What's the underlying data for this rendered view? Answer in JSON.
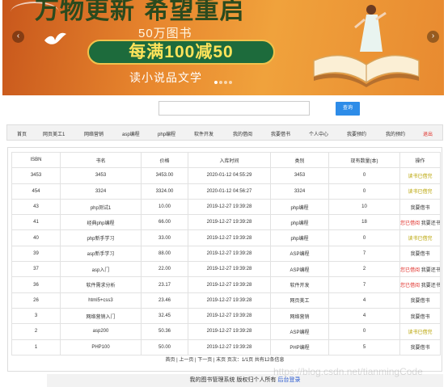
{
  "banner": {
    "title": "万物更新 希望重启",
    "subtitle": "50万图书",
    "promo": "每满100减50",
    "tagline": "读小说品文学",
    "prev_icon": "chevron-left-icon",
    "next_icon": "chevron-right-icon",
    "slide_count": 4,
    "active_slide": 1
  },
  "search": {
    "placeholder": "",
    "value": "",
    "button": "查询"
  },
  "nav": {
    "items": [
      "首页",
      "网页美工1",
      "网络营销",
      "asp编程",
      "php编程",
      "软件开发",
      "我的借阅",
      "我要借书",
      "个人中心",
      "我要预约",
      "我的预约",
      "退出"
    ]
  },
  "table": {
    "headers": [
      "ISBN",
      "书名",
      "价格",
      "入库时间",
      "类别",
      "现有数量(本)",
      "操作"
    ],
    "rows": [
      {
        "isbn": "3453",
        "name": "3453",
        "price": "3453.00",
        "time": "2020-01-12 04:55:29",
        "cat": "3453",
        "qty": "0",
        "op": "读书已借完",
        "op2": "",
        "opType": "done"
      },
      {
        "isbn": "454",
        "name": "3324",
        "price": "3324.00",
        "time": "2020-01-12 04:56:27",
        "cat": "3324",
        "qty": "0",
        "op": "读书已借完",
        "op2": "",
        "opType": "done"
      },
      {
        "isbn": "43",
        "name": "php测试1",
        "price": "10.00",
        "time": "2019-12-27 19:39:28",
        "cat": "php编程",
        "qty": "10",
        "op": "我要借书",
        "op2": "",
        "opType": "borrow"
      },
      {
        "isbn": "41",
        "name": "经典php编程",
        "price": "66.00",
        "time": "2019-12-27 19:39:28",
        "cat": "php编程",
        "qty": "18",
        "op": "您已借阅",
        "op2": "我要还书",
        "opType": "borrowed"
      },
      {
        "isbn": "40",
        "name": "php新手学习",
        "price": "33.00",
        "time": "2019-12-27 19:39:28",
        "cat": "php编程",
        "qty": "0",
        "op": "读书已借完",
        "op2": "",
        "opType": "done"
      },
      {
        "isbn": "39",
        "name": "asp新手学习",
        "price": "88.00",
        "time": "2019-12-27 19:39:28",
        "cat": "ASP编程",
        "qty": "7",
        "op": "我要借书",
        "op2": "",
        "opType": "borrow"
      },
      {
        "isbn": "37",
        "name": "asp入门",
        "price": "22.00",
        "time": "2019-12-27 19:39:28",
        "cat": "ASP编程",
        "qty": "2",
        "op": "您已借阅",
        "op2": "我要还书",
        "opType": "borrowed"
      },
      {
        "isbn": "36",
        "name": "软件需求分析",
        "price": "23.17",
        "time": "2019-12-27 19:39:28",
        "cat": "软件开发",
        "qty": "7",
        "op": "您已借阅",
        "op2": "我要还书",
        "opType": "borrowed"
      },
      {
        "isbn": "26",
        "name": "html5+css3",
        "price": "23.46",
        "time": "2019-12-27 19:39:28",
        "cat": "网页美工",
        "qty": "4",
        "op": "我要借书",
        "op2": "",
        "opType": "borrow"
      },
      {
        "isbn": "3",
        "name": "网络营销入门",
        "price": "32.45",
        "time": "2019-12-27 19:39:28",
        "cat": "网络营销",
        "qty": "4",
        "op": "我要借书",
        "op2": "",
        "opType": "borrow"
      },
      {
        "isbn": "2",
        "name": "asp200",
        "price": "50.36",
        "time": "2019-12-27 19:39:28",
        "cat": "ASP编程",
        "qty": "0",
        "op": "读书已借完",
        "op2": "",
        "opType": "done"
      },
      {
        "isbn": "1",
        "name": "PHP100",
        "price": "50.00",
        "time": "2019-12-27 19:39:28",
        "cat": "PHP编程",
        "qty": "5",
        "op": "我要借书",
        "op2": "",
        "opType": "borrow"
      }
    ]
  },
  "pager": "首页 | 上一页 | 下一页 | 末页 页次：1/1页 共有12条信息",
  "footer": {
    "text": "我的图书管理系统 版权归个人所有",
    "link": "后台登录"
  },
  "watermark": "https://blog.csdn.net/tianmingCode",
  "colors": {
    "accent": "#2d8ce8",
    "done": "#b8a300",
    "borrowed": "#e0302a"
  }
}
